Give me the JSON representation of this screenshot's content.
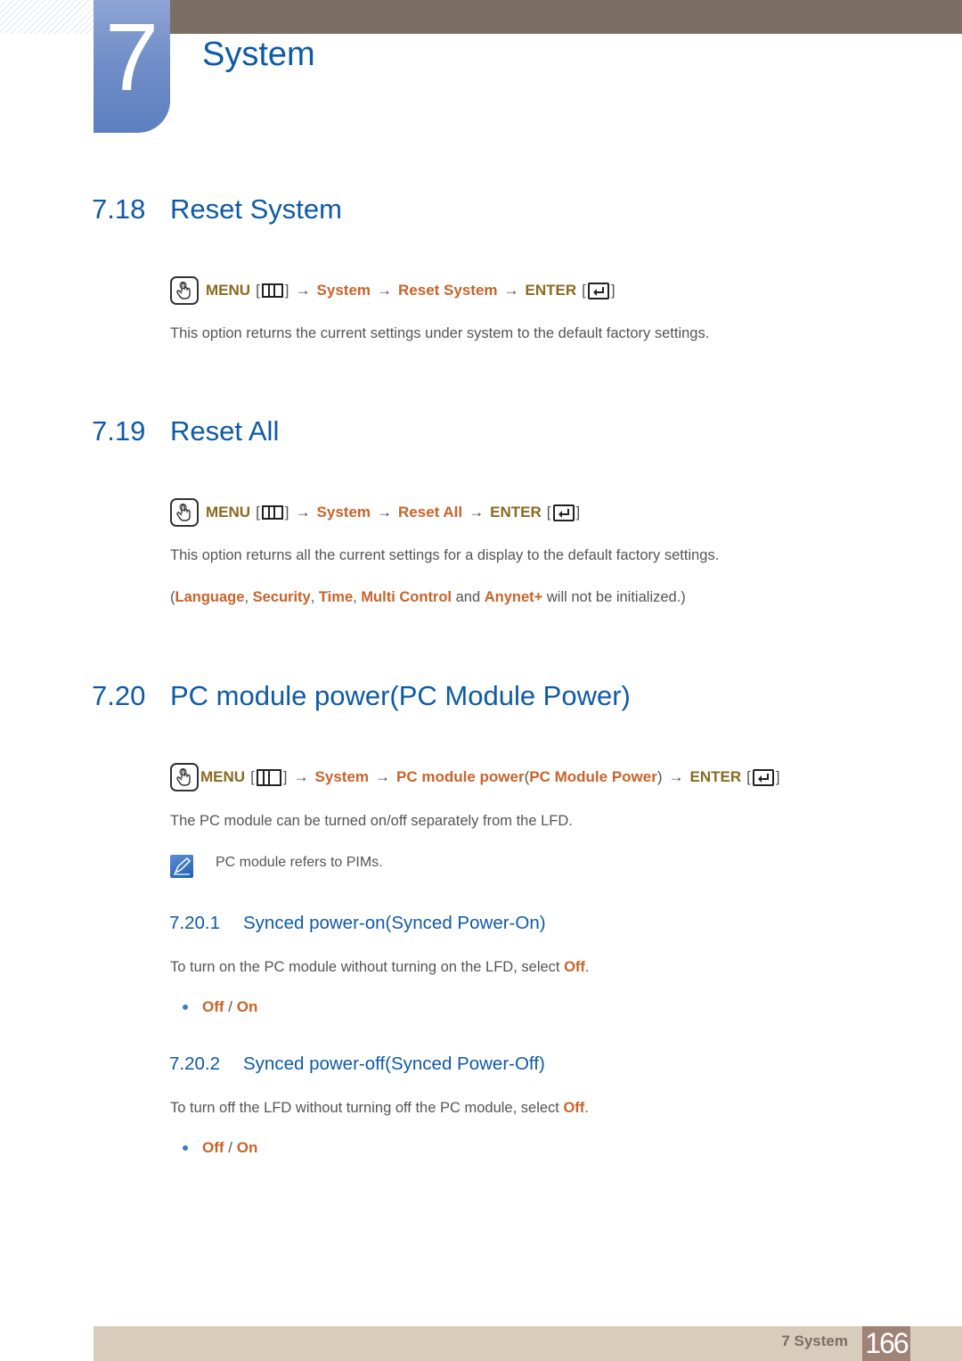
{
  "chapter": {
    "number": "7",
    "title": "System"
  },
  "icons": {
    "touch": "hand-pointer-icon",
    "menu": "menu-bars-icon",
    "enter": "enter-return-icon",
    "note": "note-pencil-icon"
  },
  "colors": {
    "heading": "#0e5aa7",
    "keyword_brown": "#8a6a1e",
    "keyword_orange": "#c8632a",
    "body": "#555555",
    "top_bar": "#7b6e62",
    "footer_bar": "#d8ccba",
    "page_box": "#9e8376",
    "chapter_tab": "#6f8cc7"
  },
  "sections": [
    {
      "number": "7.18",
      "title": "Reset System",
      "path": {
        "menu": "MENU",
        "arrow": "→",
        "items": [
          "System",
          "Reset System"
        ],
        "enter": "ENTER"
      },
      "body": "This option returns the current settings under system to the default factory settings."
    },
    {
      "number": "7.19",
      "title": "Reset All",
      "path": {
        "menu": "MENU",
        "arrow": "→",
        "items": [
          "System",
          "Reset All"
        ],
        "enter": "ENTER"
      },
      "body": "This option returns all the current settings for a display to the default factory settings.",
      "note_line": {
        "open": "(",
        "k1": "Language",
        "sep1": ", ",
        "k2": "Security",
        "sep2": ", ",
        "k3": "Time",
        "sep3": ", ",
        "k4": "Multi Control",
        "and": " and ",
        "k5": "Anynet+",
        "tail": " will not be initialized.)"
      }
    },
    {
      "number": "7.20",
      "title": "PC module power(PC Module Power)",
      "path": {
        "menu": "MENU",
        "arrow": "→",
        "items": [
          "System",
          "PC module power",
          "PC Module Power"
        ],
        "paren_open": "(",
        "paren_close": ")",
        "enter": "ENTER"
      },
      "body": "The PC module can be turned on/off separately from the LFD.",
      "note": "PC module refers to PIMs.",
      "subsections": [
        {
          "number": "7.20.1",
          "title": "Synced power-on(Synced Power-On)",
          "body_prefix": "To turn on the PC module without turning on the LFD, select ",
          "body_keyword": "Off",
          "body_suffix": ".",
          "options": {
            "a": "Off",
            "sep": " / ",
            "b": "On"
          }
        },
        {
          "number": "7.20.2",
          "title": "Synced power-off(Synced Power-Off)",
          "body_prefix": "To turn off the LFD without turning off the PC module, select ",
          "body_keyword": "Off",
          "body_suffix": ".",
          "options": {
            "a": "Off",
            "sep": " / ",
            "b": "On"
          }
        }
      ]
    }
  ],
  "footer": {
    "label": "7 System",
    "page": "166"
  }
}
